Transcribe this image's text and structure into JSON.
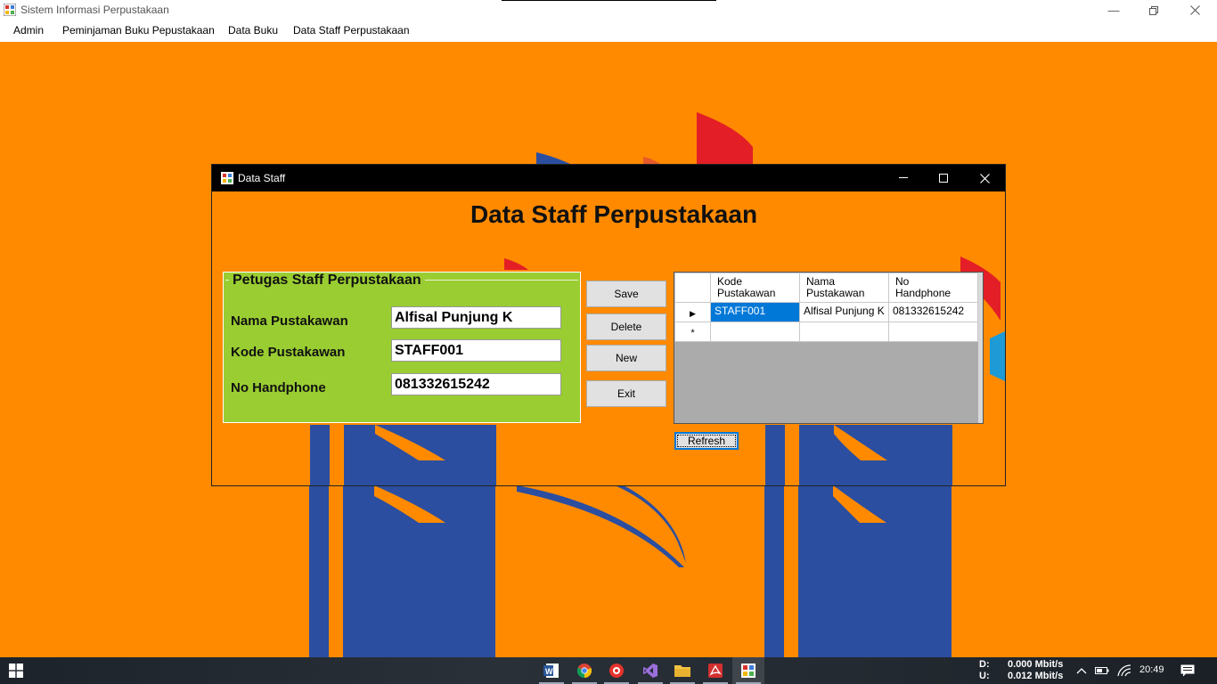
{
  "main_window": {
    "title": "Sistem Informasi Perpustakaan"
  },
  "menu": {
    "items": [
      "Admin",
      "Peminjaman Buku Pepustakaan",
      "Data Buku",
      "Data Staff Perpustakaan"
    ]
  },
  "child_window": {
    "title": "Data Staff",
    "heading": "Data Staff Perpustakaan",
    "group": {
      "title": "Petugas Staff Perpustakaan",
      "fields": [
        {
          "label": "Nama Pustakawan",
          "value": "Alfisal Punjung K"
        },
        {
          "label": "Kode Pustakawan",
          "value": "STAFF001"
        },
        {
          "label": "No Handphone",
          "value": "081332615242"
        }
      ]
    },
    "buttons": {
      "save": "Save",
      "delete": "Delete",
      "new": "New",
      "exit": "Exit",
      "refresh": "Refresh"
    },
    "grid": {
      "columns": [
        {
          "line1": "Kode",
          "line2": "Pustakawan"
        },
        {
          "line1": "Nama",
          "line2": "Pustakawan"
        },
        {
          "line1": "No",
          "line2": "Handphone"
        }
      ],
      "rows": [
        {
          "marker": "▶",
          "cells": [
            "STAFF001",
            "Alfisal Punjung K",
            "081332615242"
          ]
        },
        {
          "marker": "*",
          "cells": [
            "",
            "",
            ""
          ]
        }
      ]
    }
  },
  "taskbar": {
    "apps": [
      "word-icon",
      "chrome-icon",
      "screen-recorder-icon",
      "visual-studio-icon",
      "file-explorer-icon",
      "acrobat-icon",
      "app-form-icon"
    ],
    "network": {
      "down_label": "D:",
      "down_value": "0.000 Mbit/s",
      "up_label": "U:",
      "up_value": "0.012 Mbit/s"
    },
    "time": "20:49"
  },
  "colors": {
    "background": "#ff8a00",
    "group_box": "#9acd32",
    "selection": "#0078d7",
    "logo_blue": "#2b4ea0",
    "logo_red": "#e41e26"
  }
}
